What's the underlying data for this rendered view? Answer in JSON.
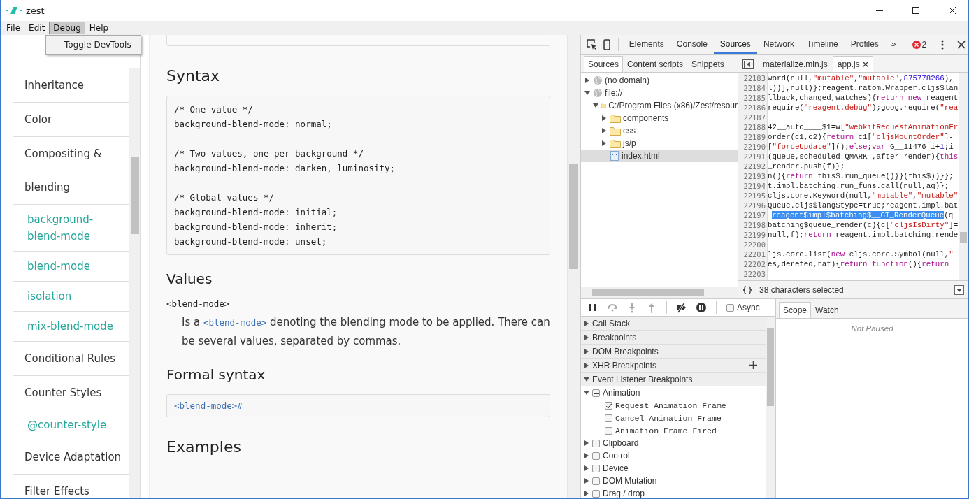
{
  "window": {
    "title": "zest"
  },
  "menu": [
    {
      "label": "File",
      "open": false
    },
    {
      "label": "Edit",
      "open": false
    },
    {
      "label": "Debug",
      "open": true
    },
    {
      "label": "Help",
      "open": false
    }
  ],
  "dropdown": {
    "items": [
      "Toggle DevTools"
    ]
  },
  "sidebar": {
    "items": [
      {
        "label": "Inheritance",
        "kind": "section"
      },
      {
        "label": "Color",
        "kind": "section"
      },
      {
        "label": "Compositing & blending",
        "kind": "section"
      },
      {
        "label": "background-blend-mode",
        "kind": "page"
      },
      {
        "label": "blend-mode",
        "kind": "page"
      },
      {
        "label": "isolation",
        "kind": "page"
      },
      {
        "label": "mix-blend-mode",
        "kind": "page"
      },
      {
        "label": "Conditional Rules",
        "kind": "section"
      },
      {
        "label": "Counter Styles",
        "kind": "section"
      },
      {
        "label": "@counter-style",
        "kind": "page"
      },
      {
        "label": "Device Adaptation",
        "kind": "section"
      },
      {
        "label": "Filter Effects",
        "kind": "section"
      }
    ]
  },
  "article": {
    "syntax_heading": "Syntax",
    "code_groups": [
      [
        "/* One value */",
        "background-blend-mode: normal;"
      ],
      [
        "/* Two values, one per background */",
        "background-blend-mode: darken, luminosity;"
      ],
      [
        "/* Global values */",
        "background-blend-mode: initial;",
        "background-blend-mode: inherit;",
        "background-blend-mode: unset;"
      ]
    ],
    "values_heading": "Values",
    "value_term": "<blend-mode>",
    "description": [
      {
        "kind": "text",
        "text": "Is a "
      },
      {
        "kind": "code",
        "text": "<blend-mode>"
      },
      {
        "kind": "text",
        "text": " denoting the blending mode to be applied. There can be several values, separated by commas."
      }
    ],
    "formal_heading": "Formal syntax",
    "formal_syntax": "<blend-mode>#",
    "examples_heading": "Examples"
  },
  "devtools": {
    "tabs": [
      {
        "label": "Elements",
        "selected": false
      },
      {
        "label": "Console",
        "selected": false
      },
      {
        "label": "Sources",
        "selected": true
      },
      {
        "label": "Network",
        "selected": false
      },
      {
        "label": "Timeline",
        "selected": false
      },
      {
        "label": "Profiles",
        "selected": false
      }
    ],
    "more": "»",
    "error_count": "2",
    "navigator_tabs": [
      {
        "label": "Sources",
        "selected": true
      },
      {
        "label": "Content scripts",
        "selected": false
      },
      {
        "label": "Snippets",
        "selected": false
      }
    ],
    "tree": [
      {
        "label": "(no domain)",
        "kind": "domain",
        "expanded": false,
        "selected": false
      },
      {
        "label": "file://",
        "kind": "domain",
        "expanded": true,
        "selected": false,
        "children": [
          {
            "label": "C:/Program Files (x86)/Zest/resour",
            "kind": "folder",
            "expanded": true,
            "selected": false,
            "children": [
              {
                "label": "components",
                "kind": "folder",
                "expanded": false,
                "selected": false
              },
              {
                "label": "css",
                "kind": "folder",
                "expanded": false,
                "selected": false
              },
              {
                "label": "js/p",
                "kind": "folder",
                "expanded": false,
                "selected": false
              },
              {
                "label": "index.html",
                "kind": "file",
                "selected": true
              }
            ]
          }
        ]
      }
    ],
    "editor_tabs": [
      {
        "label": "materialize.min.js",
        "selected": false
      },
      {
        "label": "app.js",
        "selected": true
      }
    ],
    "code_lines": [
      {
        "number": "22183",
        "segments": [
          {
            "kind": "plain",
            "text": "word(null,"
          },
          {
            "kind": "string",
            "text": "\"mutable\""
          },
          {
            "kind": "plain",
            "text": ","
          },
          {
            "kind": "string",
            "text": "\"mutable\""
          },
          {
            "kind": "plain",
            "text": ","
          },
          {
            "kind": "number",
            "text": "875778266"
          },
          {
            "kind": "plain",
            "text": "),"
          }
        ]
      },
      {
        "number": "22184",
        "segments": [
          {
            "kind": "plain",
            "text": "l))],null)};reagent.ratom.Wrapper.cljs$lan"
          }
        ]
      },
      {
        "number": "22185",
        "segments": [
          {
            "kind": "plain",
            "text": "llback,changed,watches){"
          },
          {
            "kind": "keyword",
            "text": "return new"
          },
          {
            "kind": "plain",
            "text": " reagent"
          }
        ]
      },
      {
        "number": "22186",
        "segments": [
          {
            "kind": "plain",
            "text": "require("
          },
          {
            "kind": "string",
            "text": "\"reagent.debug\""
          },
          {
            "kind": "plain",
            "text": ");goog.require("
          },
          {
            "kind": "string",
            "text": "\"rea"
          }
        ]
      },
      {
        "number": "22187"
      },
      {
        "number": "22188",
        "segments": [
          {
            "kind": "plain",
            "text": "42__auto____$1=w["
          },
          {
            "kind": "string",
            "text": "\"webkitRequestAnimationFr"
          }
        ]
      },
      {
        "number": "22189",
        "segments": [
          {
            "kind": "plain",
            "text": "order(c1,c2){"
          },
          {
            "kind": "keyword",
            "text": "return"
          },
          {
            "kind": "plain",
            "text": " c1["
          },
          {
            "kind": "string",
            "text": "\"cljsMountOrder\""
          },
          {
            "kind": "plain",
            "text": "]-"
          }
        ]
      },
      {
        "number": "22190",
        "segments": [
          {
            "kind": "plain",
            "text": "["
          },
          {
            "kind": "string",
            "text": "\"forceUpdate\""
          },
          {
            "kind": "plain",
            "text": "]();"
          },
          {
            "kind": "keyword",
            "text": "else"
          },
          {
            "kind": "plain",
            "text": ";"
          },
          {
            "kind": "keyword",
            "text": "var"
          },
          {
            "kind": "plain",
            "text": " G__11476=i+"
          },
          {
            "kind": "number",
            "text": "1"
          },
          {
            "kind": "plain",
            "text": ";i="
          }
        ]
      },
      {
        "number": "22191",
        "segments": [
          {
            "kind": "plain",
            "text": "(queue,scheduled_QMARK_,after_render){"
          },
          {
            "kind": "keyword",
            "text": "this"
          }
        ]
      },
      {
        "number": "22192",
        "segments": [
          {
            "kind": "plain",
            "text": "_render.push(f)};"
          }
        ]
      },
      {
        "number": "22193",
        "segments": [
          {
            "kind": "plain",
            "text": "n(){"
          },
          {
            "kind": "keyword",
            "text": "return"
          },
          {
            "kind": "plain",
            "text": " this$.run_queue()}}(this$))}};"
          }
        ]
      },
      {
        "number": "22194",
        "segments": [
          {
            "kind": "plain",
            "text": "t.impl.batching.run_funs.call(null,aq)};"
          }
        ]
      },
      {
        "number": "22195",
        "segments": [
          {
            "kind": "plain",
            "text": "cljs.core.Keyword(null,"
          },
          {
            "kind": "string",
            "text": "\"mutable\""
          },
          {
            "kind": "plain",
            "text": ","
          },
          {
            "kind": "string",
            "text": "\"mutable\""
          }
        ]
      },
      {
        "number": "22196",
        "segments": [
          {
            "kind": "plain",
            "text": "Queue.cljs$lang$type=true;reagent.impl.bat"
          }
        ]
      },
      {
        "number": "22197",
        "segments": [
          {
            "kind": "selected",
            "text": "reagent$impl$batching$__GT_RenderQueue"
          },
          {
            "kind": "plain",
            "text": "(q"
          }
        ]
      },
      {
        "number": "22198",
        "segments": [
          {
            "kind": "plain",
            "text": "batching$queue_render(c){c["
          },
          {
            "kind": "string",
            "text": "\"cljsIsDirty\""
          },
          {
            "kind": "plain",
            "text": "]="
          }
        ]
      },
      {
        "number": "22199",
        "segments": [
          {
            "kind": "plain",
            "text": "null,f);"
          },
          {
            "kind": "keyword",
            "text": "return"
          },
          {
            "kind": "plain",
            "text": " reagent.impl.batching.rende"
          }
        ]
      },
      {
        "number": "22200"
      },
      {
        "number": "22201",
        "segments": [
          {
            "kind": "plain",
            "text": "ljs.core.list("
          },
          {
            "kind": "keyword",
            "text": "new"
          },
          {
            "kind": "plain",
            "text": " cljs.core.Symbol(null,"
          },
          {
            "kind": "string",
            "text": "\""
          }
        ]
      },
      {
        "number": "22202",
        "segments": [
          {
            "kind": "plain",
            "text": "es,derefed,rat){"
          },
          {
            "kind": "keyword",
            "text": "return function"
          },
          {
            "kind": "plain",
            "text": "(){"
          },
          {
            "kind": "keyword",
            "text": "return"
          }
        ]
      },
      {
        "number": "22203"
      }
    ],
    "editor_status": "38 characters selected",
    "async": {
      "label": "Async",
      "checked": false
    },
    "sections": [
      {
        "label": "Call Stack",
        "expanded": false,
        "add": false
      },
      {
        "label": "Breakpoints",
        "expanded": false,
        "add": false
      },
      {
        "label": "DOM Breakpoints",
        "expanded": false,
        "add": false
      },
      {
        "label": "XHR Breakpoints",
        "expanded": false,
        "add": true
      },
      {
        "label": "Event Listener Breakpoints",
        "expanded": true,
        "add": false
      }
    ],
    "listeners": [
      {
        "label": "Animation",
        "expanded": true,
        "checked": false,
        "mixed": true,
        "children": [
          {
            "label": "Request Animation Frame",
            "checked": true
          },
          {
            "label": "Cancel Animation Frame",
            "checked": false
          },
          {
            "label": "Animation Frame Fired",
            "checked": false
          }
        ]
      },
      {
        "label": "Clipboard",
        "expanded": false,
        "checked": false,
        "mixed": false
      },
      {
        "label": "Control",
        "expanded": false,
        "checked": false,
        "mixed": false
      },
      {
        "label": "Device",
        "expanded": false,
        "checked": false,
        "mixed": false
      },
      {
        "label": "DOM Mutation",
        "expanded": false,
        "checked": false,
        "mixed": false
      },
      {
        "label": "Drag / drop",
        "expanded": false,
        "checked": false,
        "mixed": false
      }
    ],
    "side_tabs": [
      {
        "label": "Scope",
        "selected": true
      },
      {
        "label": "Watch",
        "selected": false
      }
    ],
    "scope_message": "Not Paused"
  }
}
